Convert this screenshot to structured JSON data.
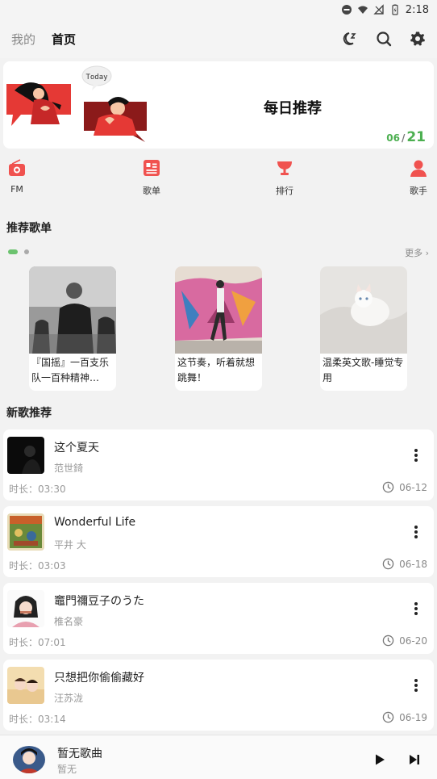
{
  "status": {
    "time": "2:18"
  },
  "tabs": [
    {
      "label": "我的"
    },
    {
      "label": "首页"
    }
  ],
  "banner": {
    "title": "每日推荐",
    "today_label": "Today",
    "month": "06",
    "separator": "/",
    "day": "21"
  },
  "quick_nav": [
    {
      "label": "FM",
      "icon": "radio-icon"
    },
    {
      "label": "歌单",
      "icon": "playlist-icon"
    },
    {
      "label": "排行",
      "icon": "trophy-icon"
    },
    {
      "label": "歌手",
      "icon": "singer-icon"
    }
  ],
  "recommend": {
    "title": "推荐歌单",
    "more_label": "更多 ›",
    "playlists": [
      {
        "name": "『国摇』一百支乐队一百种精神…"
      },
      {
        "name": "这节奏，听着就想跳舞！"
      },
      {
        "name": "温柔英文歌-睡觉专用"
      }
    ]
  },
  "new_songs": {
    "title": "新歌推荐",
    "songs": [
      {
        "name": "这个夏天",
        "artist": "范世錡",
        "duration": "时长：03:30",
        "date": "06-12"
      },
      {
        "name": "Wonderful Life",
        "artist": "平井 大",
        "duration": "时长：03:03",
        "date": "06-18"
      },
      {
        "name": "竈門禰豆子のうた",
        "artist": "椎名豪",
        "duration": "时长：07:01",
        "date": "06-20"
      },
      {
        "name": "只想把你偷偷藏好",
        "artist": "汪苏泷",
        "duration": "时长：03:14",
        "date": "06-19"
      }
    ]
  },
  "player": {
    "title": "暂无歌曲",
    "subtitle": "暂无"
  },
  "colors": {
    "accent_red": "#f0524f",
    "accent_green": "#4caf50"
  }
}
